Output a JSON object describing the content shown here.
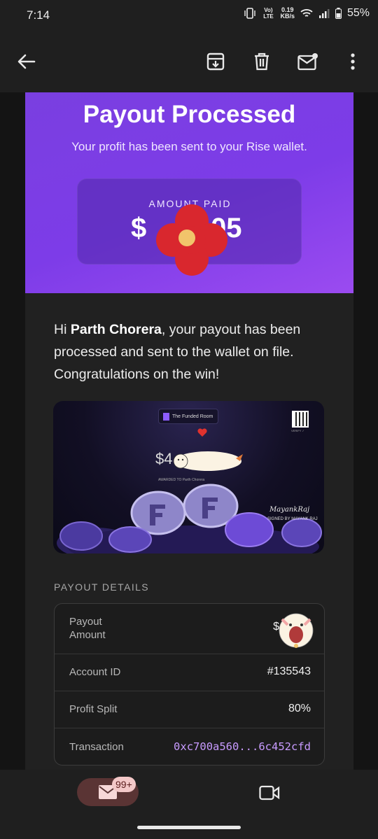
{
  "status_bar": {
    "time": "7:14",
    "network_label": "Vo) LTE",
    "speed_value": "0.19",
    "speed_unit": "KB/s",
    "battery": "55%"
  },
  "app_bar": {
    "back_icon": "arrow-left-icon",
    "archive_icon": "archive-icon",
    "delete_icon": "trash-icon",
    "mark_unread_icon": "mail-unread-icon",
    "more_icon": "more-vert-icon"
  },
  "email": {
    "hero": {
      "title": "Payout Processed",
      "subtitle": "Your profit has been sent to your Rise wallet.",
      "amount_label": "AMOUNT PAID",
      "amount_prefix": "$",
      "amount_suffix": "05"
    },
    "greeting": {
      "prefix": "Hi ",
      "name": "Parth Chorera",
      "body": ", your payout has been processed and sent to the wallet on file. Congratulations on the win!"
    },
    "certificate": {
      "brand": "The Funded Room",
      "qr_label": "VERIFY ✓",
      "amount_prefix": "$4",
      "awarded_to": "AWARDED TO Parth Chorera",
      "signature": "MayankRaj",
      "signed_by": "SIGNED BY MAYANK RAJ"
    },
    "details_label": "PAYOUT DETAILS",
    "details": [
      {
        "key": "Payout Amount",
        "value": "$"
      },
      {
        "key": "Account ID",
        "value": "#135543"
      },
      {
        "key": "Profit Split",
        "value": "80%"
      },
      {
        "key": "Transaction",
        "value": "0xc700a560...6c452cfd"
      }
    ]
  },
  "bottom_nav": {
    "mail_badge": "99+",
    "mail_icon": "mail-icon",
    "meet_icon": "video-camera-icon"
  },
  "colors": {
    "hero_gradient_start": "#7a3fe0",
    "hero_gradient_end": "#9b4bf0",
    "transaction_text": "#c89bff",
    "mail_pill": "#5a3434"
  }
}
